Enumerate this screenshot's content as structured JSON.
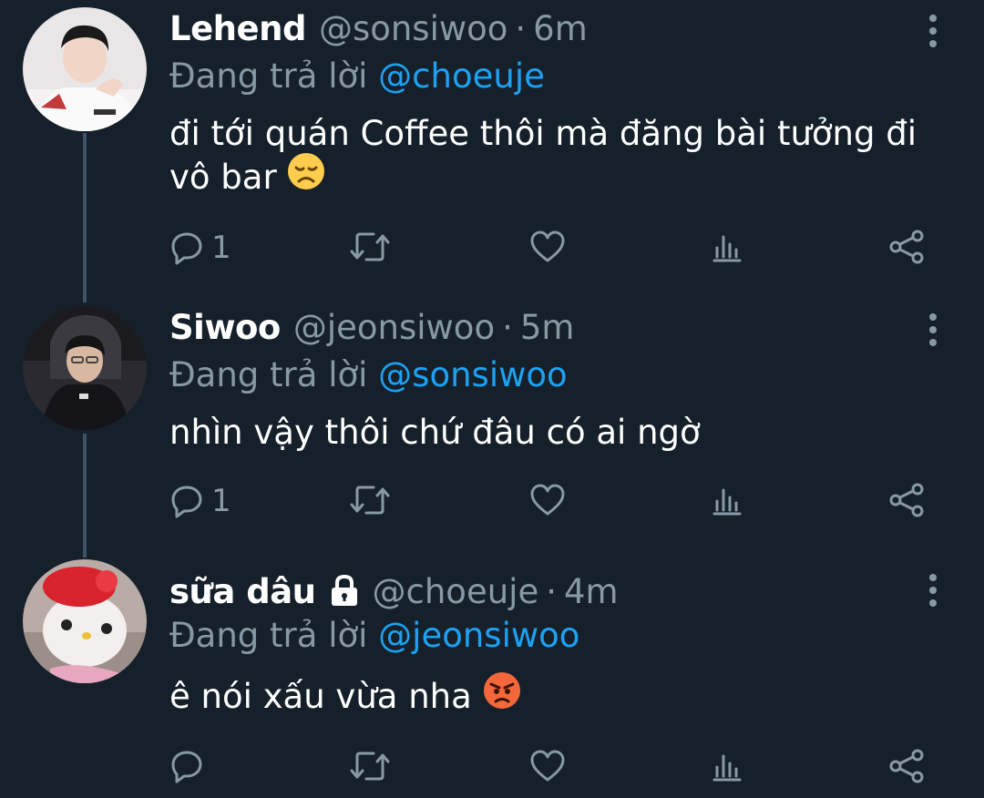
{
  "tweets": [
    {
      "name": "Lehend",
      "handle": "@sonsiwoo",
      "separator": "·",
      "time": "6m",
      "replying_prefix": "Đang trả lời",
      "replying_to": "@choeuje",
      "text": "đi tới quán Coffee thôi mà đăng bài tưởng đi vô bar",
      "emoji": "disappointed-face",
      "reply_count": "1",
      "locked": false
    },
    {
      "name": "Siwoo",
      "handle": "@jeonsiwoo",
      "separator": "·",
      "time": "5m",
      "replying_prefix": "Đang trả lời",
      "replying_to": "@sonsiwoo",
      "text": "nhìn vậy thôi chứ đâu có ai ngờ",
      "emoji": "",
      "reply_count": "1",
      "locked": false
    },
    {
      "name": "sữa dâu",
      "handle": "@choeuje",
      "separator": "·",
      "time": "4m",
      "replying_prefix": "Đang trả lời",
      "replying_to": "@jeonsiwoo",
      "text": "ê nói xấu vừa nha",
      "emoji": "angry-face",
      "reply_count": "",
      "locked": true
    }
  ],
  "icons": {
    "reply": "reply-icon",
    "retweet": "retweet-icon",
    "like": "like-icon",
    "analytics": "analytics-icon",
    "share": "share-icon",
    "more": "more-icon",
    "lock": "lock-icon"
  },
  "colors": {
    "background": "#15202b",
    "secondary_text": "#8899a6",
    "link": "#1da1f2",
    "thread_line": "#3d5466"
  }
}
